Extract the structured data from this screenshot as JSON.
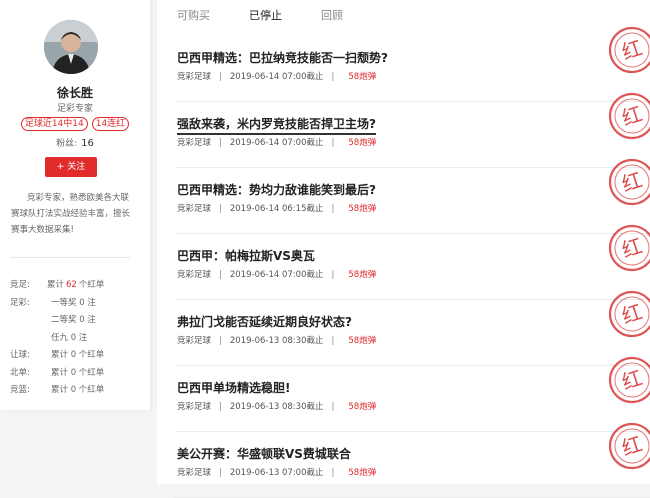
{
  "profile": {
    "name": "徐长胜",
    "role": "足彩专家",
    "badges": [
      "足球近14中14",
      "14连红"
    ],
    "fans_label": "粉丝:",
    "fans_count": "16",
    "follow_label": "+ 关注",
    "intro": "竞彩专家，熟悉欧美各大联赛球队打法实战经验丰富，擅长赛事大数据采集!",
    "stats": [
      {
        "key": "竞足:",
        "prefix": "累计",
        "value": "62",
        "suffix": "个红单"
      },
      {
        "key": "足彩:",
        "prefix": "",
        "value": "",
        "suffix": "一等奖 0 注"
      },
      {
        "key": "",
        "prefix": "",
        "value": "",
        "suffix": "二等奖 0 注"
      },
      {
        "key": "",
        "prefix": "",
        "value": "",
        "suffix": "任九 0 注"
      },
      {
        "key": "让球:",
        "prefix": "",
        "value": "",
        "suffix": "累计 0 个红单"
      },
      {
        "key": "北单:",
        "prefix": "",
        "value": "",
        "suffix": "累计 0 个红单"
      },
      {
        "key": "竞篮:",
        "prefix": "",
        "value": "",
        "suffix": "累计 0 个红单"
      }
    ]
  },
  "tabs": [
    {
      "label": "可购买",
      "active": false
    },
    {
      "label": "已停止",
      "active": true
    },
    {
      "label": "回顾",
      "active": false
    }
  ],
  "articles": [
    {
      "title": "巴西甲精选：巴拉纳竞技能否一扫颓势?",
      "category": "竞彩足球",
      "time": "2019-06-14 07:00截止",
      "price": "58炮弹",
      "stamp": "红"
    },
    {
      "title": "强敌来袭，米内罗竞技能否捍卫主场?",
      "category": "竞彩足球",
      "time": "2019-06-14 07:00截止",
      "price": "58炮弹",
      "stamp": "红"
    },
    {
      "title": "巴西甲精选：势均力敌谁能笑到最后?",
      "category": "竞彩足球",
      "time": "2019-06-14 06:15截止",
      "price": "58炮弹",
      "stamp": "红"
    },
    {
      "title": "巴西甲：帕梅拉斯VS奥瓦",
      "category": "竞彩足球",
      "time": "2019-06-14 07:00截止",
      "price": "58炮弹",
      "stamp": "红"
    },
    {
      "title": "弗拉门戈能否延续近期良好状态?",
      "category": "竞彩足球",
      "time": "2019-06-13 08:30截止",
      "price": "58炮弹",
      "stamp": "红"
    },
    {
      "title": "巴西甲单场精选稳胆!",
      "category": "竞彩足球",
      "time": "2019-06-13 08:30截止",
      "price": "58炮弹",
      "stamp": "红"
    },
    {
      "title": "美公开赛：华盛顿联VS费城联合",
      "category": "竞彩足球",
      "time": "2019-06-13 07:00截止",
      "price": "58炮弹",
      "stamp": "红"
    }
  ],
  "colors": {
    "accent": "#e02b2b",
    "stamp": "#d83a3a"
  }
}
